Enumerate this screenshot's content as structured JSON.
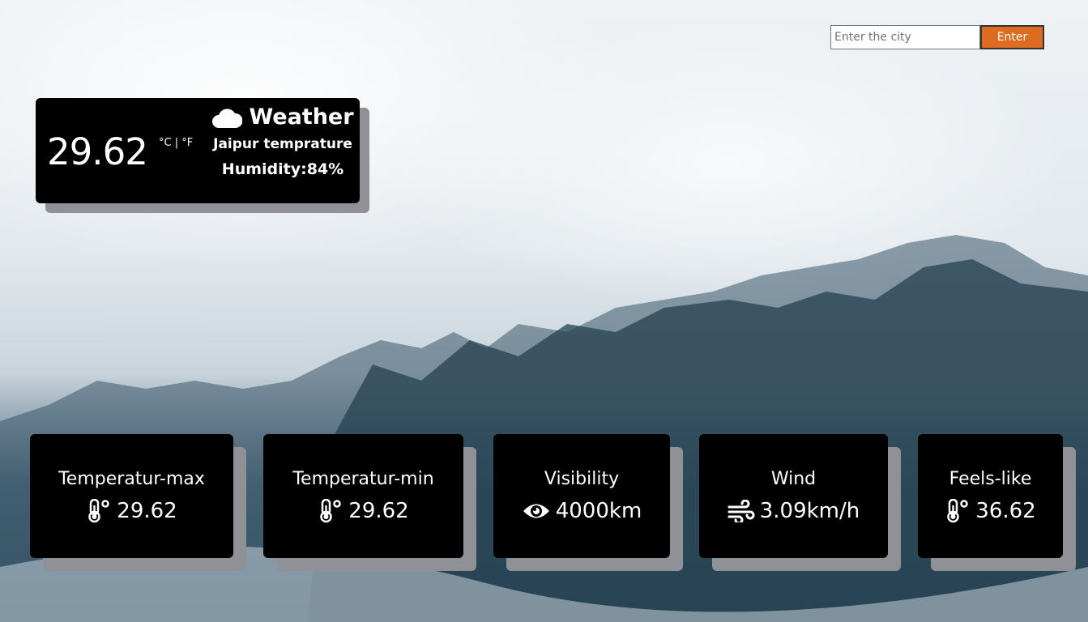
{
  "search": {
    "placeholder": "Enter the city",
    "button_label": "Enter"
  },
  "weather": {
    "temperature": "29.62",
    "unit_toggle": "°C | °F",
    "title": "Weather",
    "title_icon": "cloud-icon",
    "city_line": "Jaipur temprature",
    "humidity_line": "Humidity:84%"
  },
  "stats": [
    {
      "label": "Temperatur-max",
      "value": "29.62",
      "icon": "thermometer-icon"
    },
    {
      "label": "Temperatur-min",
      "value": "29.62",
      "icon": "thermometer-icon"
    },
    {
      "label": "Visibility",
      "value": "4000km",
      "icon": "eye-icon"
    },
    {
      "label": "Wind",
      "value": "3.09km/h",
      "icon": "wind-icon"
    },
    {
      "label": "Feels-like",
      "value": "36.62",
      "icon": "thermometer-icon"
    }
  ],
  "colors": {
    "card": "#000000",
    "shadow": "#8f9197",
    "accent": "#de6b22"
  }
}
